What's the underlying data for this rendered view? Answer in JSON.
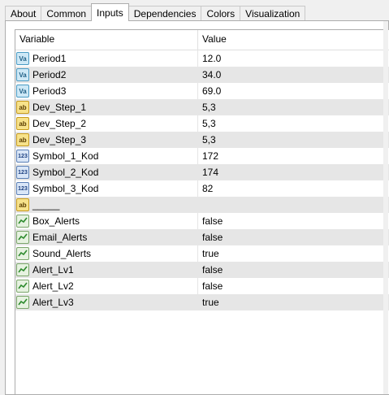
{
  "tabs": [
    {
      "label": "About",
      "active": false
    },
    {
      "label": "Common",
      "active": false
    },
    {
      "label": "Inputs",
      "active": true
    },
    {
      "label": "Dependencies",
      "active": false
    },
    {
      "label": "Colors",
      "active": false
    },
    {
      "label": "Visualization",
      "active": false
    }
  ],
  "table": {
    "col_variable": "Variable",
    "col_value": "Value",
    "rows": [
      {
        "name": "Period1",
        "value": "12.0",
        "icon": "double-icon"
      },
      {
        "name": "Period2",
        "value": "34.0",
        "icon": "double-icon"
      },
      {
        "name": "Period3",
        "value": "69.0",
        "icon": "double-icon"
      },
      {
        "name": "Dev_Step_1",
        "value": "5,3",
        "icon": "string-icon"
      },
      {
        "name": "Dev_Step_2",
        "value": "5,3",
        "icon": "string-icon"
      },
      {
        "name": "Dev_Step_3",
        "value": "5,3",
        "icon": "string-icon"
      },
      {
        "name": "Symbol_1_Kod",
        "value": "172",
        "icon": "integer-icon"
      },
      {
        "name": "Symbol_2_Kod",
        "value": "174",
        "icon": "integer-icon"
      },
      {
        "name": "Symbol_3_Kod",
        "value": "82",
        "icon": "integer-icon"
      },
      {
        "name": "_____",
        "value": "",
        "icon": "string-icon"
      },
      {
        "name": "Box_Alerts",
        "value": "false",
        "icon": "bool-icon"
      },
      {
        "name": "Email_Alerts",
        "value": "false",
        "icon": "bool-icon"
      },
      {
        "name": "Sound_Alerts",
        "value": "true",
        "icon": "bool-icon"
      },
      {
        "name": "Alert_Lv1",
        "value": "false",
        "icon": "bool-icon"
      },
      {
        "name": "Alert_Lv2",
        "value": "false",
        "icon": "bool-icon"
      },
      {
        "name": "Alert_Lv3",
        "value": "true",
        "icon": "bool-icon"
      }
    ]
  },
  "icon_glyphs": {
    "double": "Va",
    "string": "ab",
    "integer": "123"
  }
}
